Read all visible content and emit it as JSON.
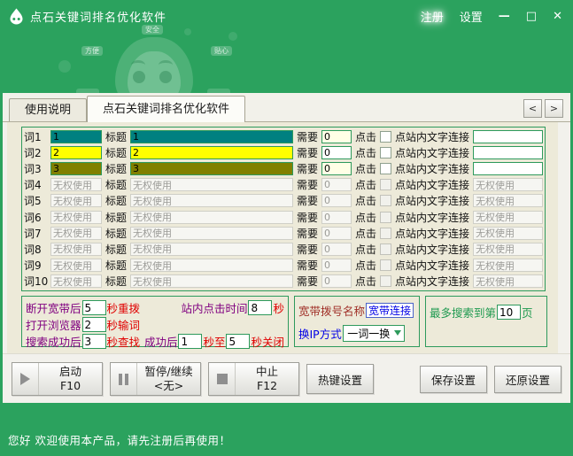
{
  "window": {
    "title": "点石关键词排名优化软件",
    "controls": {
      "register": "注册",
      "settings": "设置",
      "minimize": "—",
      "maximize": "□",
      "close": "✕"
    }
  },
  "watermark": {
    "tags": [
      "安全",
      "方便",
      "贴心"
    ]
  },
  "tabs": {
    "items": [
      {
        "label": "使用说明"
      },
      {
        "label": "点石关键词排名优化软件"
      }
    ],
    "nav_prev": "<",
    "nav_next": ">"
  },
  "rows": {
    "labels": {
      "title": "标题",
      "need": "需要",
      "click": "点击",
      "link": "点站内文字连接"
    },
    "items": [
      {
        "label": "词1",
        "word": "1",
        "title": "1",
        "need": "0",
        "link": "",
        "bg": "#008080",
        "need_bg": "#FFFFE6",
        "enabled": true
      },
      {
        "label": "词2",
        "word": "2",
        "title": "2",
        "need": "0",
        "link": "",
        "bg": "#FFFF00",
        "need_bg": "#FFFFFF",
        "enabled": true
      },
      {
        "label": "词3",
        "word": "3",
        "title": "3",
        "need": "0",
        "link": "",
        "bg": "#808000",
        "need_bg": "#FFFFE6",
        "enabled": true
      },
      {
        "label": "词4",
        "word": "无权使用",
        "title": "无权使用",
        "need": "0",
        "link": "无权使用",
        "enabled": false
      },
      {
        "label": "词5",
        "word": "无权使用",
        "title": "无权使用",
        "need": "0",
        "link": "无权使用",
        "enabled": false
      },
      {
        "label": "词6",
        "word": "无权使用",
        "title": "无权使用",
        "need": "0",
        "link": "无权使用",
        "enabled": false
      },
      {
        "label": "词7",
        "word": "无权使用",
        "title": "无权使用",
        "need": "0",
        "link": "无权使用",
        "enabled": false
      },
      {
        "label": "词8",
        "word": "无权使用",
        "title": "无权使用",
        "need": "0",
        "link": "无权使用",
        "enabled": false
      },
      {
        "label": "词9",
        "word": "无权使用",
        "title": "无权使用",
        "need": "0",
        "link": "无权使用",
        "enabled": false
      },
      {
        "label": "词10",
        "word": "无权使用",
        "title": "无权使用",
        "need": "0",
        "link": "无权使用",
        "enabled": false
      }
    ]
  },
  "settings": {
    "timing": {
      "disconnect": {
        "label": "断开宽带后",
        "value": "5",
        "suffix": "秒重拨"
      },
      "browser": {
        "label": "打开浏览器",
        "value": "2",
        "suffix": "秒输词"
      },
      "search": {
        "label": "搜索成功后",
        "value": "3",
        "suffix": "秒查找"
      },
      "site_click": {
        "label": "站内点击时间",
        "value": "8",
        "suffix": "秒"
      },
      "success": {
        "label": "成功后",
        "value": "1",
        "mid": "秒至",
        "value2": "5",
        "suffix": "秒关闭"
      }
    },
    "broadband": {
      "name_label": "宽带拨号名称",
      "name_value": "宽带连接",
      "ip_label": "换IP方式",
      "ip_value": "一词一换"
    },
    "pages": {
      "prefix": "最多搜索到第",
      "value": "10",
      "suffix": "页"
    }
  },
  "controls": {
    "start": {
      "label": "启动",
      "key": "F10"
    },
    "pause": {
      "label": "暂停/继续",
      "key": "<无>"
    },
    "stop": {
      "label": "中止",
      "key": "F12"
    },
    "hotkey": "热键设置",
    "save": "保存设置",
    "restore": "还原设置"
  },
  "statusbar": {
    "message": "您好 欢迎使用本产品，请先注册后再使用！"
  },
  "colors": {
    "window_green": "#2BA25E",
    "page_beige": "#EDEAD9",
    "group_border_green": "#2E9A5C",
    "word1_bg": "#008080",
    "word2_bg": "#FFFF00",
    "word3_bg": "#808000",
    "label_purple": "#800080",
    "label_red": "#E00000",
    "label_blue": "#0000E6",
    "label_green": "#1F9A50",
    "label_maroon": "#A03028",
    "disabled_text": "#9B9B97"
  }
}
